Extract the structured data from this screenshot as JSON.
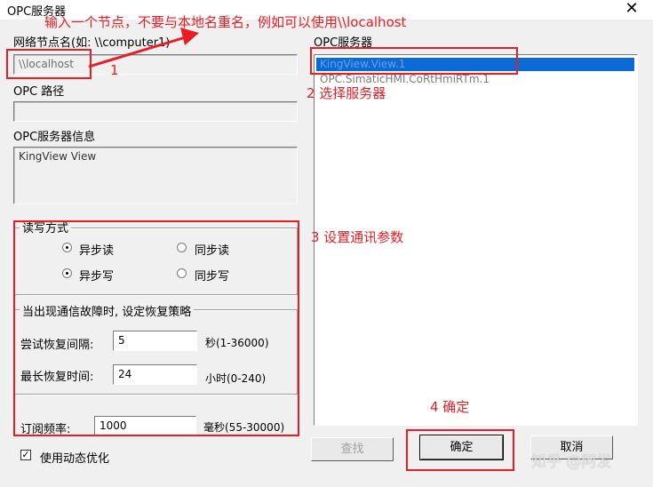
{
  "window": {
    "title": "OPC服务器",
    "close_glyph": "✕"
  },
  "node": {
    "label": "网络节点名(如: \\\\computer1)",
    "value": "\\\\localhost"
  },
  "path": {
    "label": "OPC 路径",
    "value": ""
  },
  "info": {
    "label": "OPC服务器信息",
    "value": "KingView View"
  },
  "rw_mode": {
    "title": "读写方式",
    "read_async": "异步读",
    "read_sync": "同步读",
    "write_async": "异步写",
    "write_sync": "同步写",
    "read_selected": "async",
    "write_selected": "async"
  },
  "recovery": {
    "title": "当出现通信故障时, 设定恢复策略",
    "retry_label": "尝试恢复间隔:",
    "retry_value": "5",
    "retry_unit": "秒(1-36000)",
    "max_label": "最长恢复时间:",
    "max_value": "24",
    "max_unit": "小时(0-240)"
  },
  "subscribe": {
    "label": "订阅频率:",
    "value": "1000",
    "unit": "毫秒(55-30000)"
  },
  "dynamic_opt": {
    "label": "使用动态优化",
    "checked": true
  },
  "servers": {
    "label": "OPC服务器",
    "items": [
      "KingView.View.1",
      "OPC.SimaticHMI.CoRtHmiRTm.1"
    ],
    "selected_index": 0
  },
  "buttons": {
    "find": "查找",
    "ok": "确定",
    "cancel": "取消"
  },
  "annotations": {
    "a1_text": "输入一个节点，不要与本地名重名，例如可以使用\\\\localhost",
    "a1_num": "1",
    "a2": "2 选择服务器",
    "a3": "3 设置通讯参数",
    "a4": "4 确定",
    "color": "#e81e25"
  },
  "watermark": "知乎 @阿发"
}
